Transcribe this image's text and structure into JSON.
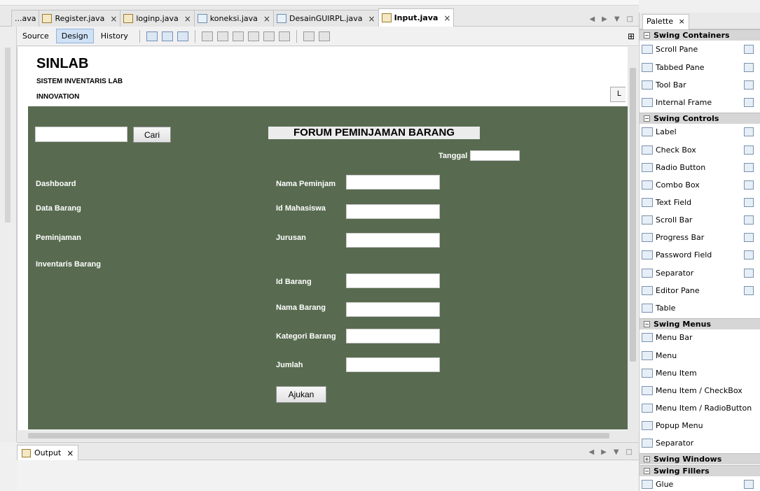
{
  "editor_tabs": [
    {
      "label": "...ava",
      "active": false,
      "closable": false
    },
    {
      "label": "Register.java",
      "active": false,
      "closable": true
    },
    {
      "label": "loginp.java",
      "active": false,
      "closable": true
    },
    {
      "label": "koneksi.java",
      "active": false,
      "closable": true
    },
    {
      "label": "DesainGUIRPL.java",
      "active": false,
      "closable": true
    },
    {
      "label": "Input.java",
      "active": true,
      "closable": true
    }
  ],
  "close_glyph": "×",
  "view_modes": {
    "source": "Source",
    "design": "Design",
    "history": "History"
  },
  "form": {
    "app_title": "SINLAB",
    "subtitle_line1": "SISTEM INVENTARIS LAB",
    "subtitle_line2": "INNOVATION",
    "clipped_button_text": "L",
    "search_button": "Cari",
    "form_title": "FORUM PEMINJAMAN BARANG",
    "date_label": "Tanggal",
    "nav": [
      "Dashboard",
      "Data Barang",
      "Peminjaman",
      "Inventaris Barang"
    ],
    "fields": {
      "nama_peminjam": "Nama Peminjam",
      "id_mahasiswa": "Id Mahasiswa",
      "jurusan": "Jurusan",
      "id_barang": "Id Barang",
      "nama_barang": "Nama Barang",
      "kategori_barang": "Kategori Barang",
      "jumlah": "Jumlah"
    },
    "submit_button": "Ajukan",
    "background_color": "#586b50"
  },
  "output_tab": "Output",
  "palette": {
    "tab": "Palette",
    "categories": {
      "containers": "Swing Containers",
      "controls": "Swing Controls",
      "menus": "Swing Menus",
      "windows": "Swing Windows",
      "fillers": "Swing Fillers"
    },
    "containers": [
      "Scroll Pane",
      "Tabbed Pane",
      "Tool Bar",
      "Internal Frame"
    ],
    "controls": [
      "Label",
      "Check Box",
      "Radio Button",
      "Combo Box",
      "Text Field",
      "Scroll Bar",
      "Progress Bar",
      "Password Field",
      "Separator",
      "Editor Pane",
      "Table"
    ],
    "menus": [
      "Menu Bar",
      "Menu",
      "Menu Item",
      "Menu Item / CheckBox",
      "Menu Item / RadioButton",
      "Popup Menu",
      "Separator"
    ],
    "fillers": [
      "Glue"
    ]
  }
}
